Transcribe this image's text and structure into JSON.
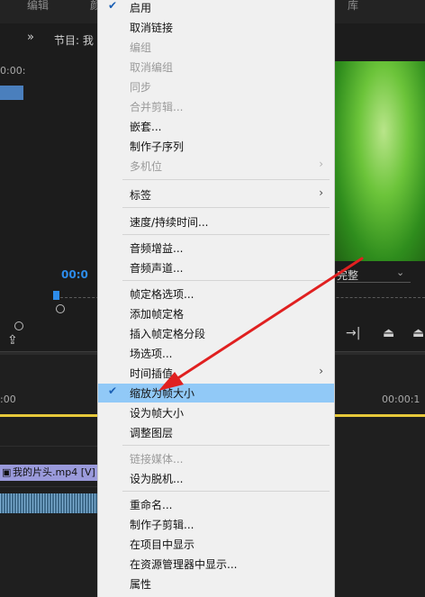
{
  "top_tabs": [
    "编辑",
    "颜",
    "库"
  ],
  "program_monitor": {
    "title": "节目: 我",
    "timecode": "00:0",
    "fit_value": "完整",
    "expand_icon": "»"
  },
  "source_panel": {
    "timecode": "0:00:"
  },
  "timeline": {
    "time_start": ":00",
    "time_end": "00:00:1",
    "clip_label": "我的片头.mp4 [V]"
  },
  "colors": {
    "highlight": "#91c9f7",
    "arrow": "#e02020",
    "timecode_blue": "#2d8ceb"
  },
  "menu": {
    "items": [
      {
        "label": "启用",
        "checked": true,
        "disabled": false,
        "submenu": false
      },
      {
        "label": "取消链接",
        "checked": false,
        "disabled": false,
        "submenu": false
      },
      {
        "label": "编组",
        "checked": false,
        "disabled": true,
        "submenu": false
      },
      {
        "label": "取消编组",
        "checked": false,
        "disabled": true,
        "submenu": false
      },
      {
        "label": "同步",
        "checked": false,
        "disabled": true,
        "submenu": false
      },
      {
        "label": "合并剪辑...",
        "checked": false,
        "disabled": true,
        "submenu": false
      },
      {
        "label": "嵌套...",
        "checked": false,
        "disabled": false,
        "submenu": false
      },
      {
        "label": "制作子序列",
        "checked": false,
        "disabled": false,
        "submenu": false
      },
      {
        "label": "多机位",
        "checked": false,
        "disabled": true,
        "submenu": true
      },
      {
        "label": "标签",
        "checked": false,
        "disabled": false,
        "submenu": true
      },
      {
        "label": "速度/持续时间...",
        "checked": false,
        "disabled": false,
        "submenu": false
      },
      {
        "label": "音频增益...",
        "checked": false,
        "disabled": false,
        "submenu": false
      },
      {
        "label": "音频声道...",
        "checked": false,
        "disabled": false,
        "submenu": false
      },
      {
        "label": "帧定格选项...",
        "checked": false,
        "disabled": false,
        "submenu": false
      },
      {
        "label": "添加帧定格",
        "checked": false,
        "disabled": false,
        "submenu": false
      },
      {
        "label": "插入帧定格分段",
        "checked": false,
        "disabled": false,
        "submenu": false
      },
      {
        "label": "场选项...",
        "checked": false,
        "disabled": false,
        "submenu": false
      },
      {
        "label": "时间插值",
        "checked": false,
        "disabled": false,
        "submenu": true
      },
      {
        "label": "缩放为帧大小",
        "checked": true,
        "disabled": false,
        "submenu": false,
        "highlighted": true
      },
      {
        "label": "设为帧大小",
        "checked": false,
        "disabled": false,
        "submenu": false
      },
      {
        "label": "调整图层",
        "checked": false,
        "disabled": false,
        "submenu": false
      },
      {
        "label": "链接媒体...",
        "checked": false,
        "disabled": true,
        "submenu": false
      },
      {
        "label": "设为脱机...",
        "checked": false,
        "disabled": false,
        "submenu": false
      },
      {
        "label": "重命名...",
        "checked": false,
        "disabled": false,
        "submenu": false
      },
      {
        "label": "制作子剪辑...",
        "checked": false,
        "disabled": false,
        "submenu": false
      },
      {
        "label": "在项目中显示",
        "checked": false,
        "disabled": false,
        "submenu": false
      },
      {
        "label": "在资源管理器中显示...",
        "checked": false,
        "disabled": false,
        "submenu": false
      },
      {
        "label": "属性",
        "checked": false,
        "disabled": false,
        "submenu": false
      }
    ]
  }
}
